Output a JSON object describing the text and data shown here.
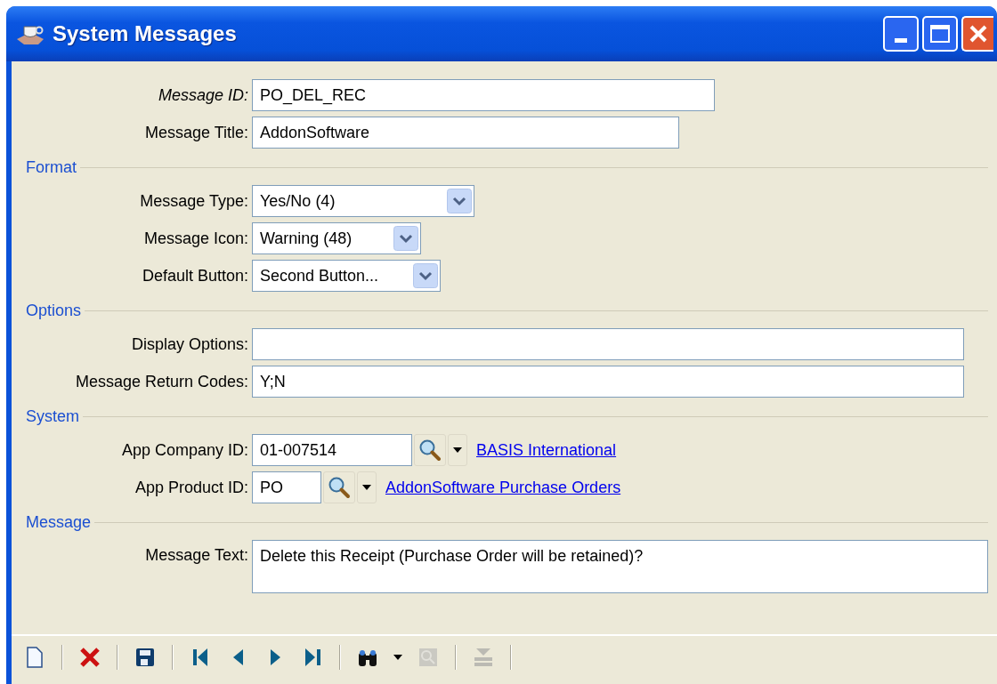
{
  "window": {
    "title": "System Messages"
  },
  "top_fields": [
    {
      "label": "Message ID:",
      "italic": true,
      "value": "PO_DEL_REC",
      "kind": "input"
    },
    {
      "label": "Message Title:",
      "italic": false,
      "value": "AddonSoftware",
      "kind": "input"
    }
  ],
  "sections": [
    {
      "title": "Format",
      "fields": [
        {
          "label": "Message Type:",
          "italic": false,
          "value": "Yes/No (4)",
          "kind": "select"
        },
        {
          "label": "Message Icon:",
          "italic": false,
          "value": "Warning (48)",
          "kind": "select"
        },
        {
          "label": "Default Button:",
          "italic": false,
          "value": "Second Button...",
          "kind": "select"
        }
      ]
    },
    {
      "title": "Options",
      "fields": [
        {
          "label": "Display Options:",
          "italic": false,
          "kind": "input"
        },
        {
          "label": "Message Return Codes:",
          "italic": false,
          "value": "Y;N",
          "kind": "input"
        }
      ]
    },
    {
      "title": "System",
      "fields": [
        {
          "label": "App Company ID:",
          "italic": false,
          "value": "01-007514",
          "kind": "lookup",
          "link": "BASIS International"
        },
        {
          "label": "App Product ID:",
          "italic": false,
          "value": "PO",
          "kind": "lookup",
          "link": "AddonSoftware Purchase Orders"
        }
      ]
    },
    {
      "title": "Message",
      "fields": [
        {
          "label": "Message Text:",
          "italic": false,
          "value": "Delete this Receipt (Purchase Order will be retained)?",
          "kind": "textarea"
        }
      ]
    }
  ],
  "toolbar": [
    {
      "kind": "new",
      "disabled": false
    },
    {
      "kind": "separator"
    },
    {
      "kind": "delete",
      "disabled": false
    },
    {
      "kind": "separator"
    },
    {
      "kind": "save",
      "disabled": false
    },
    {
      "kind": "separator"
    },
    {
      "kind": "first",
      "disabled": false
    },
    {
      "kind": "prev",
      "disabled": false
    },
    {
      "kind": "next",
      "disabled": false
    },
    {
      "kind": "last",
      "disabled": false
    },
    {
      "kind": "separator"
    },
    {
      "kind": "find",
      "disabled": false
    },
    {
      "kind": "dropdown",
      "disabled": false
    },
    {
      "kind": "zoom",
      "disabled": true
    },
    {
      "kind": "separator"
    },
    {
      "kind": "insert",
      "disabled": true
    },
    {
      "kind": "separator"
    }
  ]
}
